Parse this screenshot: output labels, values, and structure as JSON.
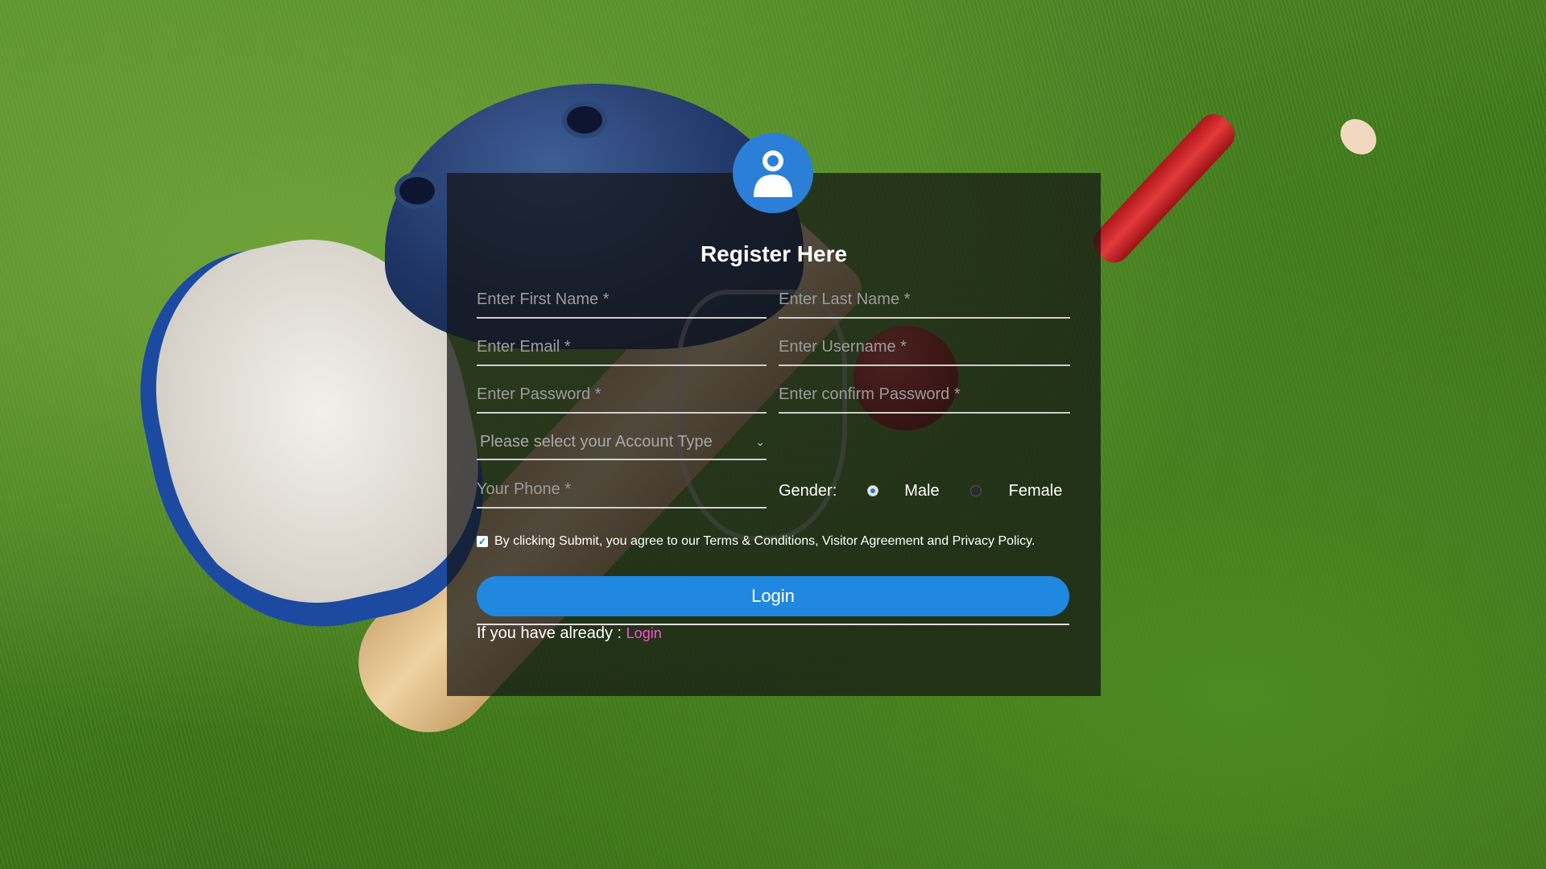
{
  "form": {
    "title": "Register Here",
    "first_name_placeholder": "Enter First Name *",
    "last_name_placeholder": "Enter Last Name *",
    "email_placeholder": "Enter Email *",
    "username_placeholder": "Enter Username *",
    "password_placeholder": "Enter Password *",
    "confirm_password_placeholder": "Enter confirm Password *",
    "account_type_selected": "Please select your Account Type",
    "phone_placeholder": "Your Phone *",
    "gender_label": "Gender:",
    "gender_options": [
      "Male",
      "Female"
    ],
    "gender_selected": "Male",
    "agreement_text": "By clicking Submit, you agree to our Terms & Conditions, Visitor Agreement and Privacy Policy.",
    "agreement_checked": true,
    "submit_label": "Login",
    "already_text": "If you have already : ",
    "login_link": "Login"
  },
  "colors": {
    "accent": "#2188e0",
    "avatar": "#2c7fd6",
    "link": "#ff4fd8"
  },
  "icons": {
    "avatar": "user-icon",
    "dropdown": "chevron-down-icon"
  }
}
